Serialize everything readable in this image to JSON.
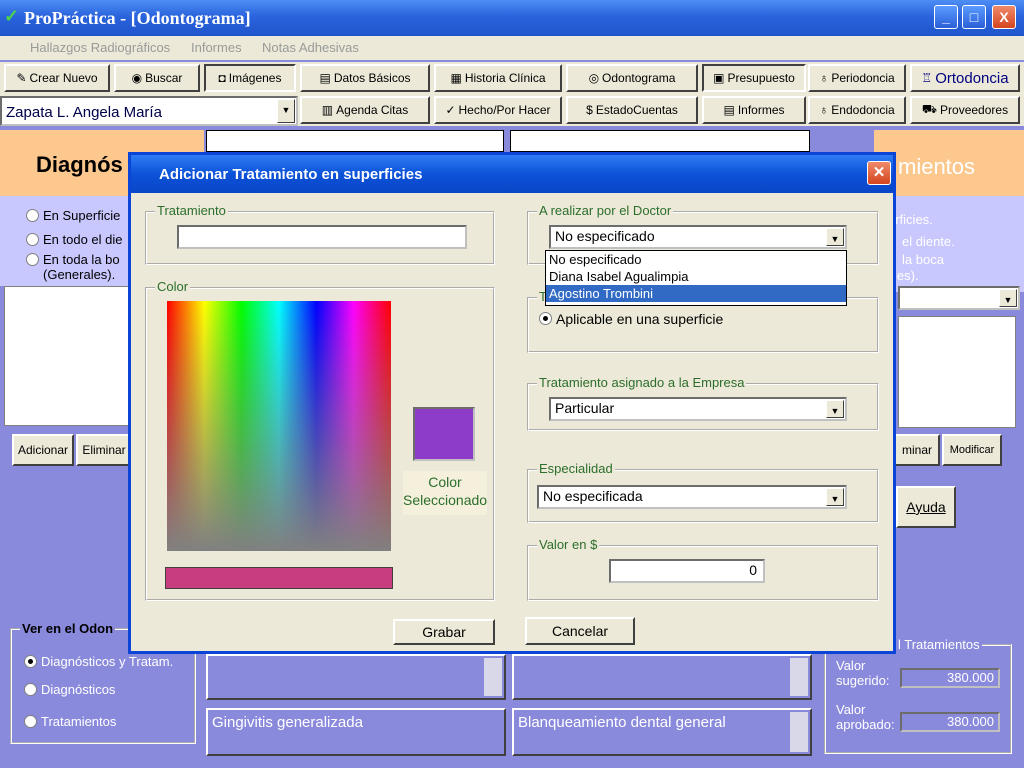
{
  "window": {
    "title": "ProPráctica - [Odontograma]",
    "controls": {
      "minimize": "_",
      "maximize": "□",
      "close": "X"
    }
  },
  "menu": [
    "Hallazgos Radiográficos",
    "Informes",
    "Notas Adhesivas"
  ],
  "toolbar": {
    "row1": [
      "Crear Nuevo",
      "Buscar",
      "Imágenes",
      "Datos Básicos",
      "Historia Clínica",
      "Odontograma",
      "Presupuesto",
      "Periodoncia",
      "Ortodoncia"
    ],
    "row2": [
      "Agenda Citas",
      "Hecho/Por Hacer",
      "EstadoCuentas",
      "Informes",
      "Endodoncia",
      "Proveedores"
    ],
    "patient": "Zapata L. Angela María"
  },
  "left_panel": {
    "heading": "Diagnós",
    "options": [
      "En Superficie",
      "En todo el die",
      "En toda la bo (Generales)."
    ],
    "buttons": [
      "Adicionar",
      "Eliminar"
    ]
  },
  "right_panel": {
    "heading": "mientos",
    "options": [
      "erficies.",
      "el diente.",
      "la boca",
      "les)."
    ],
    "buttons": [
      "minar",
      "Modificar"
    ],
    "ayuda": "Ayuda"
  },
  "bottom": {
    "ver_title": "Ver en el Odon",
    "ver_options": [
      "Diagnósticos y Tratam.",
      "Diagnósticos",
      "Tratamientos"
    ],
    "diag_text": "Gingivitis generalizada",
    "trat_text": "Blanqueamiento dental general",
    "totals_title": "l Tratamientos",
    "valor_sugerido_label": "Valor sugerido:",
    "valor_sugerido": "380.000",
    "valor_aprobado_label": "Valor aprobado:",
    "valor_aprobado": "380.000"
  },
  "dialog": {
    "title": "Adicionar Tratamiento en  superficies",
    "tratamiento_label": "Tratamiento",
    "tratamiento_value": "",
    "color_label": "Color",
    "color_selected_label": "Color Seleccionado",
    "doctor_label": "A realizar por el Doctor",
    "doctor_value": "No especificado",
    "doctor_options": [
      "No especificado",
      "Diana Isabel Agualimpia",
      "Agostino Trombini"
    ],
    "doctor_highlighted": "Agostino Trombini",
    "tipo_label": "T",
    "tipo_option": "Aplicable en una superficie",
    "empresa_label": "Tratamiento asignado a la Empresa",
    "empresa_value": "Particular",
    "especialidad_label": "Especialidad",
    "especialidad_value": "No especificada",
    "valor_label": "Valor en $",
    "valor_value": "0",
    "grabar": "Grabar",
    "cancelar": "Cancelar",
    "selected_color": "#8c3cc8",
    "hue_color": "#c83c80"
  }
}
